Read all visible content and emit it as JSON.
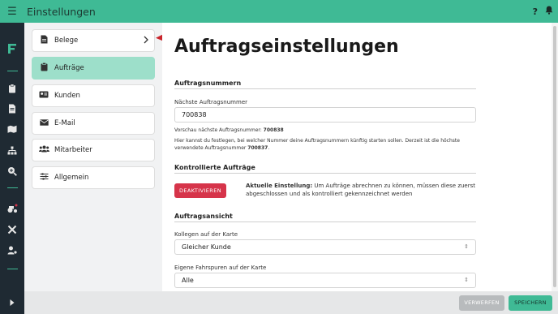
{
  "header": {
    "title": "Einstellungen",
    "help_label": "?"
  },
  "colors": {
    "accent": "#3fba95",
    "rail": "#1f2a33",
    "danger": "#d6344a",
    "active_nav": "#9ddfca"
  },
  "subnav": {
    "items": [
      {
        "label": "Belege",
        "icon": "document-icon"
      },
      {
        "label": "Aufträge",
        "icon": "clipboard-icon"
      },
      {
        "label": "Kunden",
        "icon": "id-card-icon"
      },
      {
        "label": "E-Mail",
        "icon": "envelope-icon"
      },
      {
        "label": "Mitarbeiter",
        "icon": "users-icon"
      },
      {
        "label": "Allgemein",
        "icon": "sliders-icon"
      }
    ]
  },
  "main": {
    "title": "Auftragseinstellungen",
    "numbers": {
      "heading": "Auftragsnummern",
      "label": "Nächste Auftragsnummer",
      "value": "700838",
      "preview_prefix": "Vorschau nächste Auftragsnummer: ",
      "preview_value": "700838",
      "hint_text": "Hier kannst du festlegen, bei welcher Nummer deine Auftragsnummern künftig starten sollen. Derzeit ist die höchste verwendete Auftragsnummer ",
      "hint_value": "700837",
      "hint_end": "."
    },
    "controlled": {
      "heading": "Kontrollierte Aufträge",
      "button": "DEAKTIVIEREN",
      "current_label": "Aktuelle Einstellung:",
      "current_text": " Um Aufträge abrechnen zu können, müssen diese zuerst abgeschlossen und als kontrolliert gekennzeichnet werden"
    },
    "view": {
      "heading": "Auftragsansicht",
      "colleagues_label": "Kollegen auf der Karte",
      "colleagues_value": "Gleicher Kunde",
      "tracks_label": "Eigene Fahrspuren auf der Karte",
      "tracks_value": "Alle"
    }
  },
  "footer": {
    "discard": "VERWERFEN",
    "save": "SPEICHERN"
  }
}
